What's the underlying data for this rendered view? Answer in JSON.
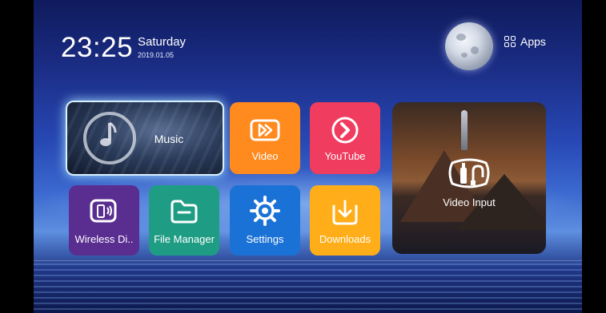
{
  "status": {
    "time": "23:25",
    "day": "Saturday",
    "date": "2019.01.05"
  },
  "apps_button": {
    "label": "Apps",
    "icon": "grid-icon"
  },
  "tiles": [
    {
      "id": "music",
      "label": "Music",
      "icon": "music-note-icon"
    },
    {
      "id": "video",
      "label": "Video",
      "icon": "play-video-icon",
      "color": "#ff8a1e"
    },
    {
      "id": "youtube",
      "label": "YouTube",
      "icon": "youtube-arrow-icon",
      "color": "#f03c5e"
    },
    {
      "id": "video-input",
      "label": "Video Input",
      "icon": "video-input-icon"
    },
    {
      "id": "wireless-display",
      "label": "Wireless Di..",
      "icon": "wireless-display-icon",
      "color": "#5a2d91"
    },
    {
      "id": "file-manager",
      "label": "File Manager",
      "icon": "folder-icon",
      "color": "#1f9d84"
    },
    {
      "id": "settings",
      "label": "Settings",
      "icon": "gear-icon",
      "color": "#1b72d6"
    },
    {
      "id": "downloads",
      "label": "Downloads",
      "icon": "download-icon",
      "color": "#ffad18"
    }
  ]
}
